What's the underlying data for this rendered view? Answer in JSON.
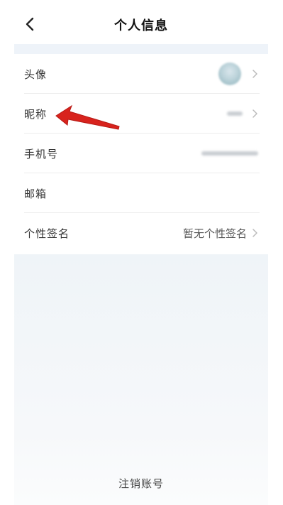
{
  "header": {
    "title": "个人信息",
    "back_icon": "chevron-left-icon"
  },
  "profile_rows": [
    {
      "label": "头像",
      "value": ""
    },
    {
      "label": "昵称",
      "value": ""
    },
    {
      "label": "手机号",
      "value": ""
    },
    {
      "label": "邮箱",
      "value": ""
    },
    {
      "label": "个性签名",
      "value": "暂无个性签名"
    }
  ],
  "footer": {
    "deactivate_label": "注销账号"
  },
  "colors": {
    "background": "#ffffff",
    "section_band": "#eef3f9",
    "divider": "#ececec",
    "annotation_arrow": "#d8231d"
  }
}
